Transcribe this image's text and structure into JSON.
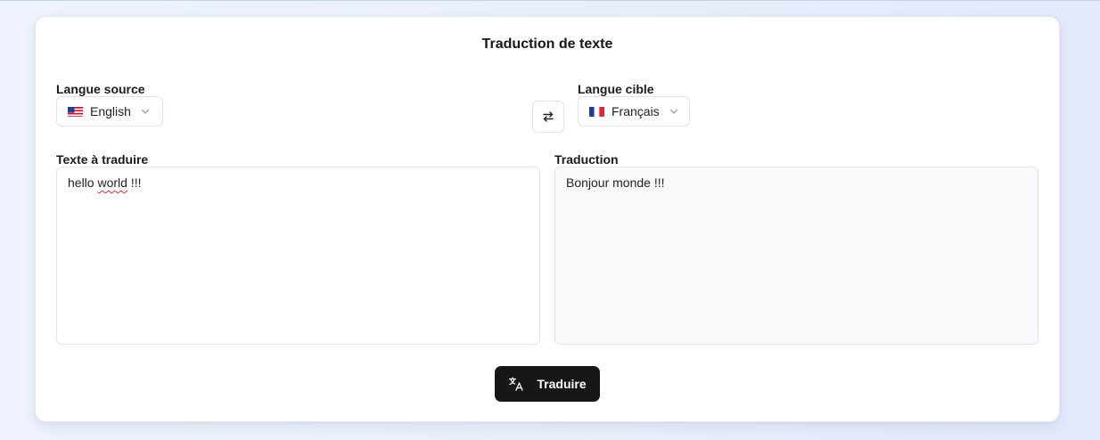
{
  "card": {
    "title": "Traduction de texte"
  },
  "source_language": {
    "label": "Langue source",
    "selected": "English",
    "flag": "us-flag-icon"
  },
  "target_language": {
    "label": "Langue cible",
    "selected": "Français",
    "flag": "fr-flag-icon"
  },
  "swap_button": {
    "icon": "swap-arrows-icon"
  },
  "input": {
    "label": "Texte à traduire",
    "value_prefix": "hello ",
    "value_misspelled": "world",
    "value_suffix": " !!!"
  },
  "output": {
    "label": "Traduction",
    "value": "Bonjour monde !!!"
  },
  "translate_button": {
    "label": "Traduire",
    "icon": "translate-icon"
  },
  "colors": {
    "button_bg": "#171717",
    "accent_text": "#161616",
    "output_bg": "#f8f9fb",
    "spellcheck": "#e03030"
  }
}
